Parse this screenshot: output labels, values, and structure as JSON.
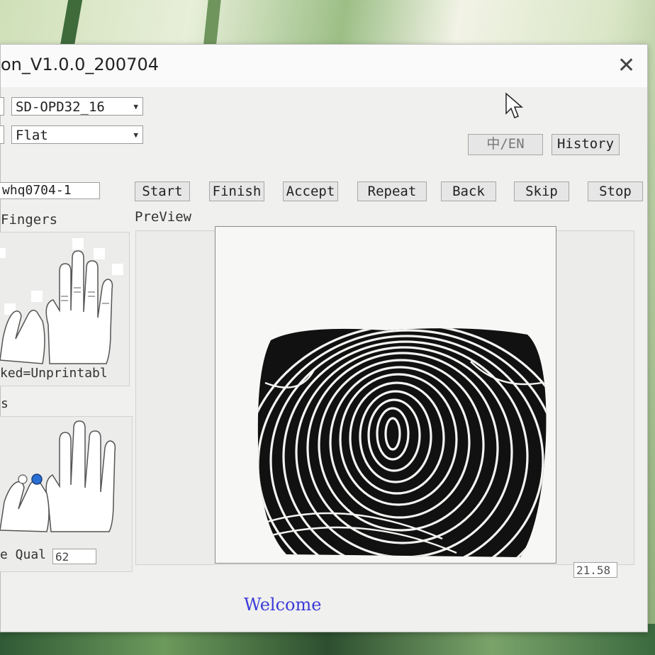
{
  "window": {
    "title": "on_V1.0.0_200704"
  },
  "settings": {
    "device_combo": "SD-OPD32_16",
    "mode_combo": "Flat",
    "lang_button": "中/EN",
    "history_button": "History"
  },
  "toolbar": {
    "id_value": "whq0704-1",
    "buttons": [
      "Start",
      "Finish",
      "Accept",
      "Repeat",
      "Back",
      "Skip",
      "Stop"
    ]
  },
  "fingers_panel": {
    "title": "Fingers",
    "caption": "ked=Unprintabl"
  },
  "quality_panel": {
    "stub_label": "s",
    "qual_label": "e Qual",
    "qual_value": "62"
  },
  "preview": {
    "label": "PreView",
    "score": "21.58"
  },
  "status": {
    "message": "Welcome"
  }
}
